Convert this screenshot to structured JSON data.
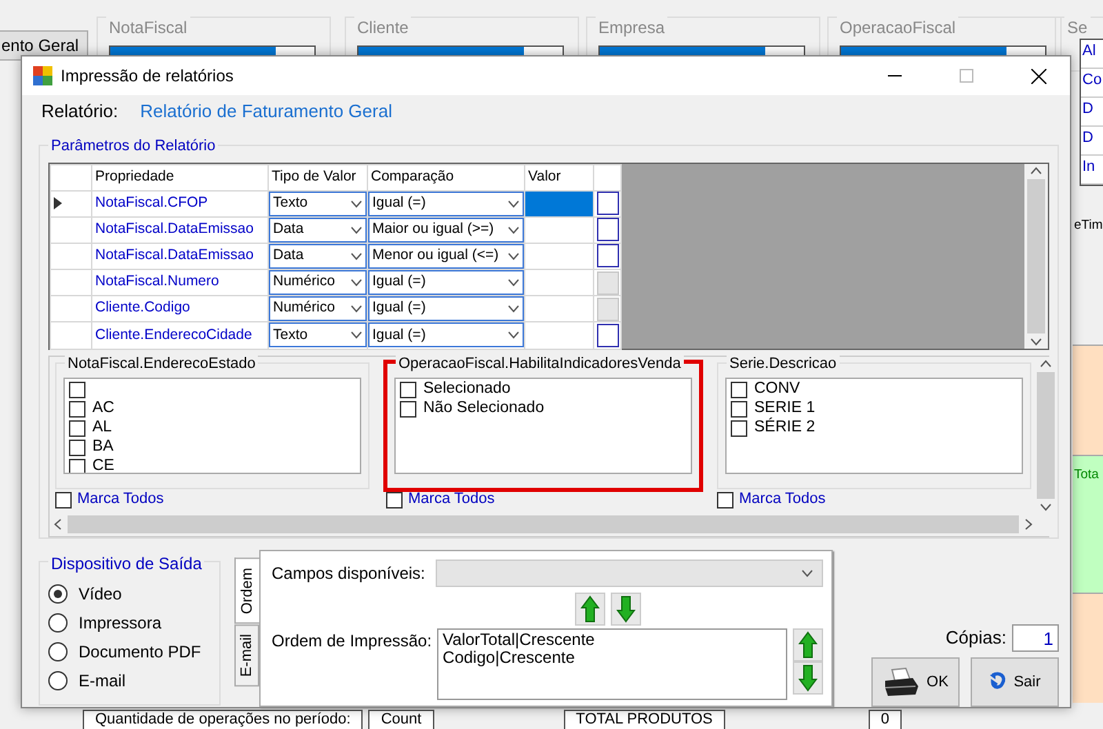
{
  "background_app": {
    "left_button": "ento Geral",
    "groups": [
      {
        "title": "NotaFiscal"
      },
      {
        "title": "Cliente"
      },
      {
        "title": "Empresa"
      },
      {
        "title": "OperacaoFiscal"
      },
      {
        "title": "Se"
      }
    ],
    "right_list": [
      "Al",
      "Co",
      "D",
      "D",
      "In"
    ],
    "right_headers": [
      "eTim",
      "Tota"
    ],
    "footer": [
      "Quantidade de operações no período:",
      "Count",
      "TOTAL PRODUTOS",
      "0"
    ]
  },
  "dialog": {
    "title": "Impressão de relatórios",
    "report_label": "Relatório:",
    "report_name": "Relatório de Faturamento Geral",
    "parameters": {
      "title": "Parâmetros do Relatório",
      "columns": [
        "Propriedade",
        "Tipo de Valor",
        "Comparação",
        "Valor"
      ],
      "rows": [
        {
          "property": "NotaFiscal.CFOP",
          "value_type": "Texto",
          "comparison": "Igual (=)",
          "current": true,
          "button_enabled": true
        },
        {
          "property": "NotaFiscal.DataEmissao",
          "value_type": "Data",
          "comparison": "Maior ou igual (>=)",
          "current": false,
          "button_enabled": true
        },
        {
          "property": "NotaFiscal.DataEmissao",
          "value_type": "Data",
          "comparison": "Menor ou igual (<=)",
          "current": false,
          "button_enabled": true
        },
        {
          "property": "NotaFiscal.Numero",
          "value_type": "Numérico",
          "comparison": "Igual (=)",
          "current": false,
          "button_enabled": false
        },
        {
          "property": "Cliente.Codigo",
          "value_type": "Numérico",
          "comparison": "Igual (=)",
          "current": false,
          "button_enabled": false
        },
        {
          "property": "Cliente.EnderecoCidade",
          "value_type": "Texto",
          "comparison": "Igual (=)",
          "current": false,
          "button_enabled": true
        }
      ],
      "filters": [
        {
          "title": "NotaFiscal.EnderecoEstado",
          "highlighted": false,
          "items": [
            {
              "checked": false
            },
            {
              "label": "AC",
              "checked": false
            },
            {
              "label": "AL",
              "checked": false
            },
            {
              "label": "BA",
              "checked": false
            },
            {
              "label": "CE",
              "checked": false
            }
          ],
          "mark_all": {
            "label": "Marca Todos",
            "checked": false
          }
        },
        {
          "title": "OperacaoFiscal.HabilitaIndicadoresVenda",
          "highlighted": true,
          "items": [
            {
              "label": "Selecionado",
              "checked": false
            },
            {
              "label": "Não Selecionado",
              "checked": false
            }
          ],
          "mark_all": {
            "label": "Marca Todos",
            "checked": false
          }
        },
        {
          "title": "Serie.Descricao",
          "highlighted": false,
          "items": [
            {
              "label": "CONV",
              "checked": false
            },
            {
              "label": "SERIE 1",
              "checked": false
            },
            {
              "label": "SÉRIE 2",
              "checked": false
            }
          ],
          "mark_all": {
            "label": "Marca Todos",
            "checked": false
          }
        }
      ]
    },
    "output": {
      "title": "Dispositivo de Saída",
      "options": [
        {
          "label": "Vídeo",
          "selected": true
        },
        {
          "label": "Impressora",
          "selected": false
        },
        {
          "label": "Documento PDF",
          "selected": false
        },
        {
          "label": "E-mail",
          "selected": false
        }
      ]
    },
    "tabs": [
      {
        "label": "Ordem",
        "selected": true
      },
      {
        "label": "E-mail",
        "selected": false
      }
    ],
    "fields_label": "Campos disponíveis:",
    "order_label": "Ordem de Impressão:",
    "order_items": [
      "ValorTotal|Crescente",
      "Codigo|Crescente"
    ],
    "copies_label": "Cópias:",
    "copies": "1",
    "buttons": [
      {
        "label": "OK",
        "kind": "print"
      },
      {
        "label": "Sair",
        "kind": "exit"
      }
    ]
  }
}
